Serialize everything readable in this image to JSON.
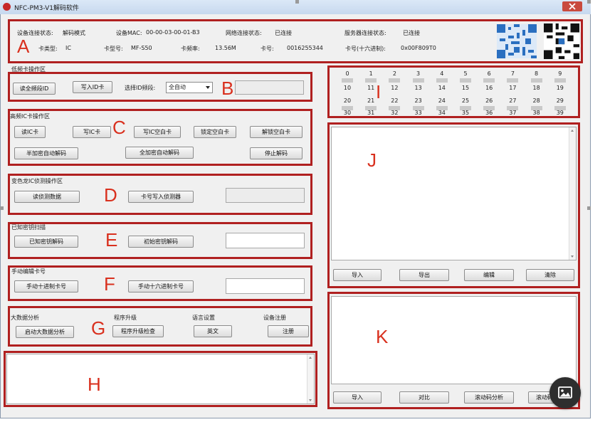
{
  "window": {
    "title": "NFC-PM3-V1解码软件"
  },
  "status": {
    "device_conn_label": "设备连接状态:",
    "device_conn_value": "解码模式",
    "mac_label": "设备MAC:",
    "mac_value": "00-00-03-00-01-B3",
    "net_label": "网络连接状态:",
    "net_value": "已连接",
    "server_label": "服务器连接状态:",
    "server_value": "已连接",
    "card_type_label": "卡类型:",
    "card_type_value": "IC",
    "card_model_label": "卡型号:",
    "card_model_value": "MF-S50",
    "freq_label": "卡频率:",
    "freq_value": "13.56M",
    "card_no_label": "卡号:",
    "card_no_value": "0016255344",
    "card_hex_label": "卡号(十六进制):",
    "card_hex_value": "0x00F809T0"
  },
  "sections": {
    "b_title": "低频卡操作区",
    "c_title": "高频IC卡操作区",
    "d_title": "变色龙IC侦测操作区",
    "e_title": "已知密钥扫描",
    "f_title": "手动编辑卡号",
    "g_bigdata": "大数据分析",
    "g_upgrade": "程序升级",
    "g_lang": "语言设置",
    "g_reg": "设备注册"
  },
  "buttons": {
    "read_all_id": "读全频段ID",
    "write_id": "写入ID卡",
    "read_ic": "读IC卡",
    "write_ic": "写IC卡",
    "write_ic_blank": "写IC空白卡",
    "lock_blank": "锁定空白卡",
    "unlock_blank": "解锁空白卡",
    "half_auto": "半加密自动解码",
    "full_auto": "全加密自动解码",
    "stop": "停止解码",
    "read_detect": "读侦测数据",
    "write_detect": "卡号写入侦测器",
    "known_key": "已知密钥解码",
    "initial_key": "初始密钥解码",
    "manual_dec": "手动十进制卡号",
    "manual_hex": "手动十六进制卡号",
    "start_bigdata": "启动大数据分析",
    "check_upgrade": "程序升级检查",
    "english": "英文",
    "register": "注册",
    "j_import": "导入",
    "j_export": "导出",
    "j_edit": "编辑",
    "j_clear": "清除",
    "k_import": "导入",
    "k_compare": "对比",
    "k_rolling": "滚动码分析",
    "k_more": "滚动码"
  },
  "freq_band": {
    "label": "选择ID频段:",
    "value": "全自动"
  },
  "sectors_top": [
    "0",
    "1",
    "2",
    "3",
    "4",
    "5",
    "6",
    "7",
    "8",
    "9"
  ],
  "sectors_row2": [
    "10",
    "11",
    "12",
    "13",
    "14",
    "15",
    "16",
    "17",
    "18",
    "19"
  ],
  "sectors_row3": [
    "20",
    "21",
    "22",
    "23",
    "24",
    "25",
    "26",
    "27",
    "28",
    "29"
  ],
  "sectors_bottom": [
    "30",
    "31",
    "32",
    "33",
    "34",
    "35",
    "36",
    "37",
    "38",
    "39"
  ],
  "annotations": {
    "A": "A",
    "B": "B",
    "C": "C",
    "D": "D",
    "E": "E",
    "F": "F",
    "G": "G",
    "H": "H",
    "I": "I",
    "J": "J",
    "K": "K"
  },
  "colors": {
    "annotation_red": "#b02020",
    "label_red": "#d9301e",
    "window_bg": "#f0f0f0",
    "titlebar": "#c6d8ee"
  },
  "icons": {
    "app": "app-logo-icon",
    "close": "close-icon",
    "qr1": "qr-code-icon",
    "qr2": "qr-code-icon",
    "fab": "image-icon"
  }
}
